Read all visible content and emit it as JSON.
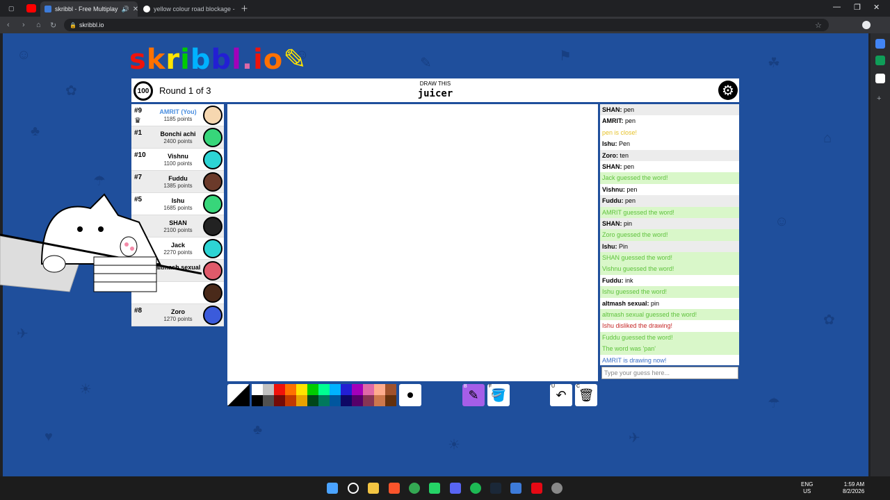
{
  "browser": {
    "tabs": [
      {
        "label": "skribbl - Free Multiplay",
        "active": true
      },
      {
        "label": "yellow colour road blockage - G",
        "active": false
      }
    ],
    "url": "skribbl.io"
  },
  "game": {
    "logo": "skribbl.io",
    "timer": "100",
    "round": "Round 1 of 3",
    "draw_label": "DRAW THIS",
    "word": "juicer",
    "players": [
      {
        "rank": "#9",
        "name": "AMRIT (You)",
        "points": "1185 points",
        "you": true,
        "color": "#f6d7b0"
      },
      {
        "rank": "#1",
        "name": "Bonchi achi",
        "points": "2400 points",
        "color": "#37d67a"
      },
      {
        "rank": "#10",
        "name": "Vishnu",
        "points": "1100 points",
        "color": "#2dd4d4"
      },
      {
        "rank": "#7",
        "name": "Fuddu",
        "points": "1385 points",
        "color": "#6b3a2a"
      },
      {
        "rank": "#5",
        "name": "Ishu",
        "points": "1685 points",
        "color": "#37d67a"
      },
      {
        "rank": "",
        "name": "SHAN",
        "points": "2100 points",
        "color": "#222222"
      },
      {
        "rank": "",
        "name": "Jack",
        "points": "2270 points",
        "color": "#2dd4d4"
      },
      {
        "rank": "",
        "name": "altmash sexual",
        "points": "",
        "color": "#e05a6a"
      },
      {
        "rank": "",
        "name": "",
        "points": "",
        "color": "#4a2a1a"
      },
      {
        "rank": "#8",
        "name": "Zoro",
        "points": "1270 points",
        "color": "#3b5bdb"
      }
    ],
    "chat": [
      {
        "who": "SHAN:",
        "text": "pen",
        "type": "normal"
      },
      {
        "who": "AMRIT:",
        "text": "pen",
        "type": "normal"
      },
      {
        "who": "",
        "text": "pen is close!",
        "type": "yellow"
      },
      {
        "who": "Ishu:",
        "text": "Pen",
        "type": "normal"
      },
      {
        "who": "Zoro:",
        "text": "ten",
        "type": "normal"
      },
      {
        "who": "SHAN:",
        "text": "pen",
        "type": "normal"
      },
      {
        "who": "",
        "text": "Jack guessed the word!",
        "type": "green"
      },
      {
        "who": "Vishnu:",
        "text": "pen",
        "type": "normal"
      },
      {
        "who": "Fuddu:",
        "text": "pen",
        "type": "normal"
      },
      {
        "who": "",
        "text": "AMRIT guessed the word!",
        "type": "green"
      },
      {
        "who": "SHAN:",
        "text": "pin",
        "type": "normal"
      },
      {
        "who": "",
        "text": "Zoro guessed the word!",
        "type": "green"
      },
      {
        "who": "Ishu:",
        "text": "Pin",
        "type": "normal"
      },
      {
        "who": "",
        "text": "SHAN guessed the word!",
        "type": "green"
      },
      {
        "who": "",
        "text": "Vishnu guessed the word!",
        "type": "green"
      },
      {
        "who": "Fuddu:",
        "text": "ink",
        "type": "normal"
      },
      {
        "who": "",
        "text": "Ishu guessed the word!",
        "type": "green"
      },
      {
        "who": "altmash sexual:",
        "text": "pin",
        "type": "normal"
      },
      {
        "who": "",
        "text": "altmash sexual guessed the word!",
        "type": "green"
      },
      {
        "who": "",
        "text": "Ishu disliked the drawing!",
        "type": "red"
      },
      {
        "who": "",
        "text": "Fuddu guessed the word!",
        "type": "green"
      },
      {
        "who": "",
        "text": "The word was 'pan'",
        "type": "green"
      },
      {
        "who": "",
        "text": "AMRIT is drawing now!",
        "type": "blue"
      }
    ],
    "chat_placeholder": "Type your guess here...",
    "palette_top": [
      "#ffffff",
      "#c1c1c1",
      "#ef130b",
      "#ff7100",
      "#ffe400",
      "#00cc00",
      "#00ff91",
      "#00b2ff",
      "#231fd3",
      "#a300ba",
      "#df69a7",
      "#ffac8e",
      "#a0522d"
    ],
    "palette_bottom": [
      "#000000",
      "#505050",
      "#740b07",
      "#c23800",
      "#e8a200",
      "#004619",
      "#00785d",
      "#00569e",
      "#0e0865",
      "#550069",
      "#873554",
      "#cc774d",
      "#63300d"
    ],
    "tool_keys": [
      "B",
      "F",
      "U",
      "C"
    ]
  },
  "system": {
    "lang": "ENG",
    "region": "US",
    "time": "1:59 AM",
    "date": "8/2/2026"
  }
}
